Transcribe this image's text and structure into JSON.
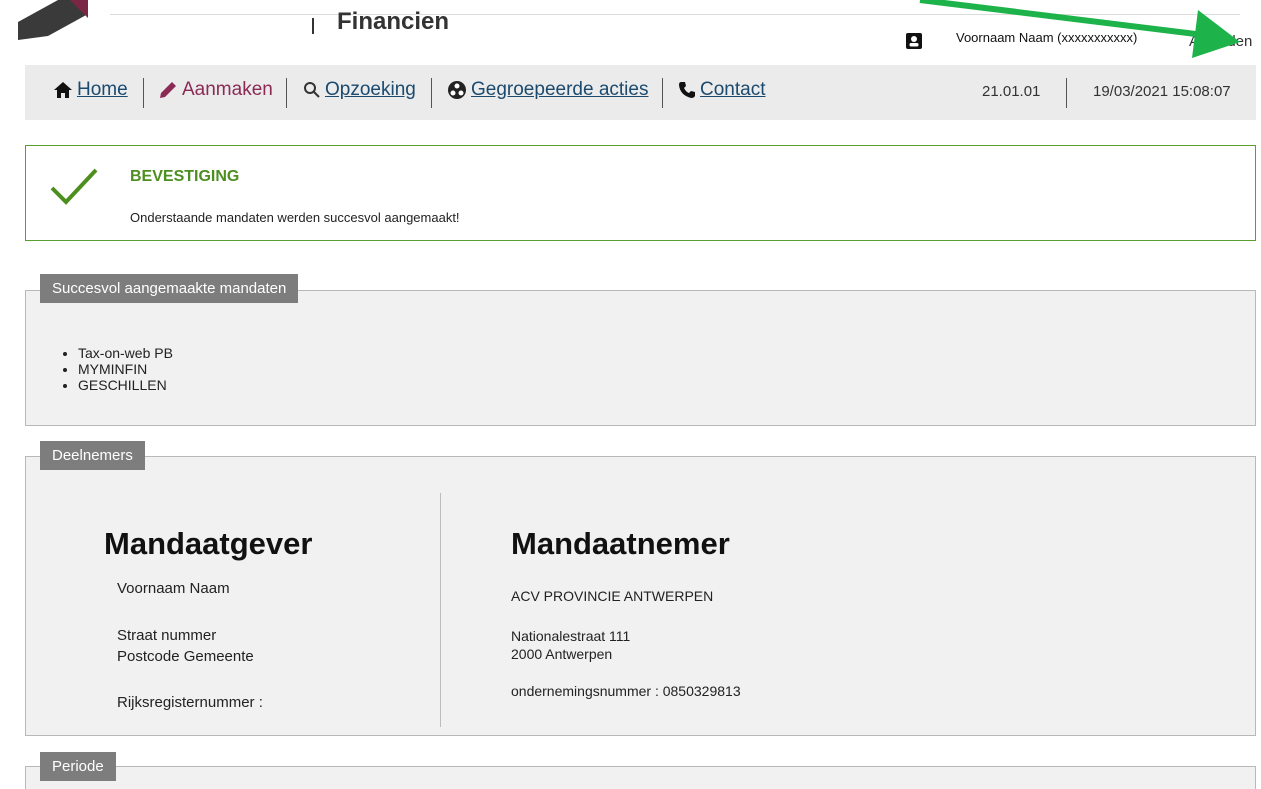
{
  "header": {
    "brand": "Financien",
    "user_name": "Voornaam Naam (xxxxxxxxxxx)",
    "logout": "Afmelden"
  },
  "nav": {
    "home": "Home",
    "create": "Aanmaken",
    "search": "Opzoeking",
    "grouped": "Gegroepeerde acties",
    "contact": "Contact",
    "version": "21.01.01",
    "datetime": "19/03/2021 15:08:07"
  },
  "confirmation": {
    "title": "BEVESTIGING",
    "message": "Onderstaande mandaten werden succesvol aangemaakt!"
  },
  "created_mandates": {
    "title": "Succesvol aangemaakte mandaten",
    "items": [
      "Tax-on-web PB",
      "MYMINFIN",
      "GESCHILLEN"
    ]
  },
  "participants": {
    "title": "Deelnemers",
    "giver": {
      "heading": "Mandaatgever",
      "name": "Voornaam Naam",
      "street": "Straat nummer",
      "city": "Postcode Gemeente",
      "rrn_label": "Rijksregisternummer :"
    },
    "receiver": {
      "heading": "Mandaatnemer",
      "name": "ACV PROVINCIE ANTWERPEN",
      "street": "Nationalestraat 111",
      "city": "2000 Antwerpen",
      "company_number": "ondernemingsnummer : 0850329813"
    }
  },
  "period": {
    "title": "Periode"
  },
  "colors": {
    "accent_green": "#4d8f1f",
    "nav_link": "#1b4a6e",
    "active_link": "#8a2a55",
    "arrow": "#1db34a"
  }
}
